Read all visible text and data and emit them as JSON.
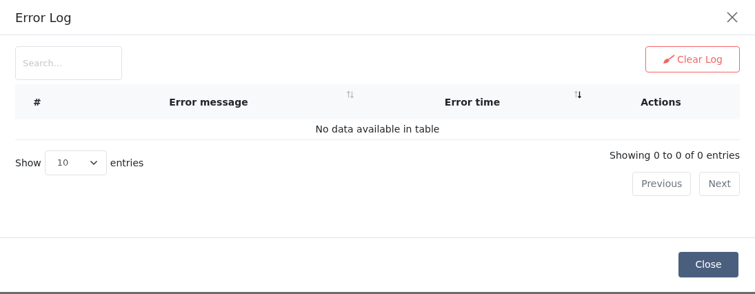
{
  "dialog": {
    "title": "Error Log"
  },
  "search": {
    "placeholder": "Search..."
  },
  "clear_button": {
    "label": "Clear Log"
  },
  "table": {
    "columns": [
      {
        "label": "#"
      },
      {
        "label": "Error message",
        "sortable": true,
        "sorted": false
      },
      {
        "label": "Error time",
        "sortable": true,
        "sorted": true,
        "descending": true
      },
      {
        "label": "Actions"
      }
    ],
    "empty_message": "No data available in table"
  },
  "length": {
    "prefix": "Show",
    "value": "10",
    "suffix": "entries"
  },
  "info": "Showing 0 to 0 of 0 entries",
  "pagination": [
    {
      "label": "Previous",
      "disabled": true
    },
    {
      "label": "Next",
      "disabled": true
    }
  ],
  "footer": {
    "close_label": "Close"
  }
}
